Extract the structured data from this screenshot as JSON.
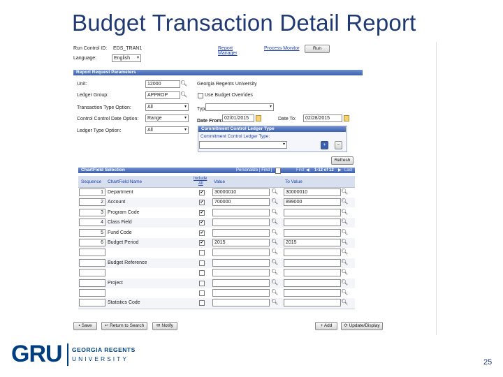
{
  "slide": {
    "title": "Budget Transaction Detail Report",
    "page_number": "25"
  },
  "logo": {
    "short": "GRU",
    "line1": "GEORGIA REGENTS",
    "line2": "UNIVERSITY"
  },
  "run": {
    "run_control_label": "Run Control ID:",
    "run_control_value": "EDS_TRAN1",
    "language_label": "Language:",
    "language_value": "English",
    "report_manager_line1": "Report",
    "report_manager_line2": "Manager",
    "process_monitor": "Process Monitor",
    "run_button": "Run"
  },
  "params": {
    "section_title": "Report Request Parameters",
    "unit_label": "Unit:",
    "unit_value": "12000",
    "unit_desc": "Georgia Regents University",
    "ledger_group_label": "Ledger Group:",
    "ledger_group_value": "APPROP",
    "use_budget_overrides": "Use Budget Overrides",
    "trans_type_label": "Transaction Type Option:",
    "trans_type_value": "All",
    "type_label": "Type:",
    "date_option_label": "Control Control Date Option:",
    "date_option_value": "Range",
    "date_from_label": "Date From:",
    "date_from_value": "02/01/2015",
    "date_to_label": "Date To:",
    "date_to_value": "02/28/2015",
    "ledger_type_label": "Ledger Type Option:",
    "ledger_type_value": "All",
    "cc_section_title": "Commitment Control Ledger Type",
    "cc_ledger_type_label": "Commitment Control Ledger Type:",
    "plus_icon": "+",
    "minus_icon": "−",
    "refresh_button": "Refresh"
  },
  "chartfield": {
    "section_title": "ChartField Selection",
    "nav_personalize": "Personalize | Find |",
    "nav_first": "First",
    "nav_count": "1-12 of 12",
    "nav_last": "Last",
    "col_sequence": "Sequence",
    "col_name": "ChartField Name",
    "col_include_line1": "Include",
    "col_include_line2": "All",
    "col_value": "Value",
    "col_to_value": "To Value",
    "rows": [
      {
        "seq": "1",
        "name": "Department",
        "checked": true,
        "value": "30000010",
        "to_value": "30000010"
      },
      {
        "seq": "2",
        "name": "Account",
        "checked": true,
        "value": "700000",
        "to_value": "899000"
      },
      {
        "seq": "3",
        "name": "Program Code",
        "checked": true,
        "value": "",
        "to_value": ""
      },
      {
        "seq": "4",
        "name": "Class Field",
        "checked": true,
        "value": "",
        "to_value": ""
      },
      {
        "seq": "5",
        "name": "Fund Code",
        "checked": true,
        "value": "",
        "to_value": ""
      },
      {
        "seq": "6",
        "name": "Budget Period",
        "checked": true,
        "value": "2015",
        "to_value": "2015"
      },
      {
        "seq": "",
        "name": "",
        "checked": false,
        "value": "",
        "to_value": ""
      },
      {
        "seq": "",
        "name": "Budget Reference",
        "checked": false,
        "value": "",
        "to_value": ""
      },
      {
        "seq": "",
        "name": "",
        "checked": false,
        "value": "",
        "to_value": ""
      },
      {
        "seq": "",
        "name": "Project",
        "checked": false,
        "value": "",
        "to_value": ""
      },
      {
        "seq": "",
        "name": "",
        "checked": false,
        "value": "",
        "to_value": ""
      },
      {
        "seq": "",
        "name": "Statistics Code",
        "checked": false,
        "value": "",
        "to_value": ""
      }
    ]
  },
  "footer": {
    "save": "Save",
    "return_to_search": "Return to Search",
    "notify": "Notify",
    "add": "Add",
    "update_display": "Update/Display"
  },
  "colors": {
    "title": "#1f3a73",
    "section_bar": "#4a6cb8",
    "logo": "#003f7f"
  }
}
